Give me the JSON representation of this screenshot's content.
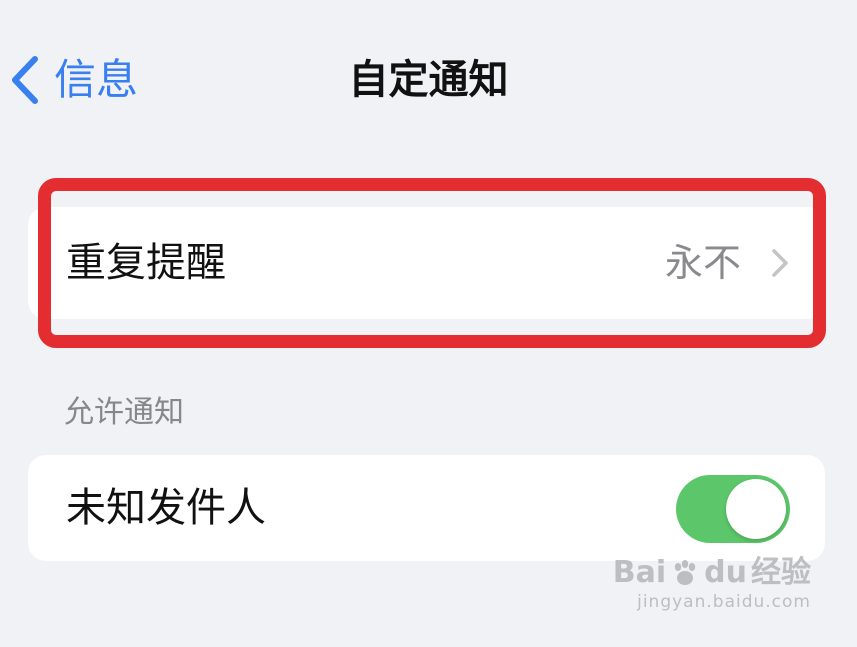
{
  "nav": {
    "back_label": "信息",
    "title": "自定通知"
  },
  "repeat_alert": {
    "label": "重复提醒",
    "value": "永不"
  },
  "allow_notifications": {
    "header": "允许通知",
    "unknown_senders": {
      "label": "未知发件人",
      "enabled": true
    }
  },
  "watermark": {
    "brand_left": "Bai",
    "brand_right": "du",
    "brand_cn": "经验",
    "url": "jingyan.baidu.com"
  },
  "colors": {
    "accent": "#3a7ff0",
    "toggle_on": "#5cc76a",
    "highlight": "#e42d30",
    "background": "#f0f2f6"
  },
  "icons": {
    "back": "chevron-left-icon",
    "disclosure": "chevron-right-icon",
    "watermark_paw": "paw-icon"
  }
}
